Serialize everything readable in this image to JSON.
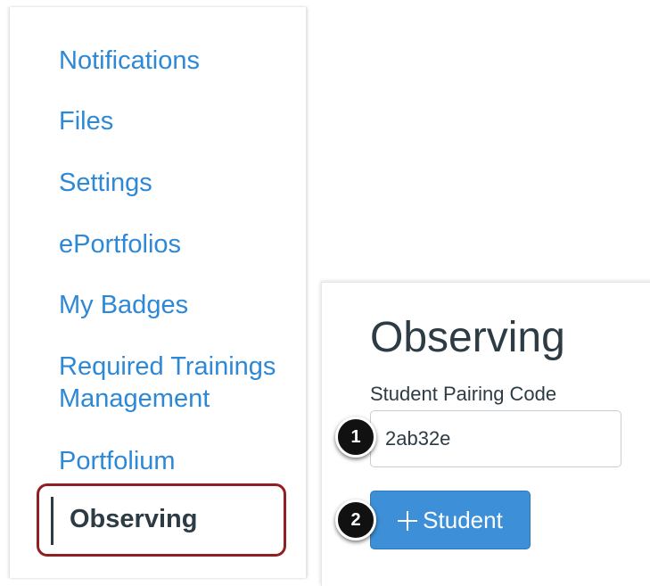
{
  "sidebar": {
    "items": [
      {
        "label": "Notifications"
      },
      {
        "label": "Files"
      },
      {
        "label": "Settings"
      },
      {
        "label": "ePortfolios"
      },
      {
        "label": "My Badges"
      },
      {
        "label": "Required Trainings Management"
      },
      {
        "label": "Portfolium"
      },
      {
        "label": "Observing"
      }
    ],
    "active_item": "Observing"
  },
  "main": {
    "title": "Observing",
    "pairing_field": {
      "label": "Student Pairing Code",
      "value": "2ab32e"
    },
    "add_button": {
      "icon": "plus-icon",
      "label": "Student"
    }
  },
  "callouts": {
    "step1": "1",
    "step2": "2"
  },
  "colors": {
    "link": "#2d88d6",
    "text": "#2d3b45",
    "button": "#3d8fd8",
    "highlight": "#8f1f22"
  }
}
